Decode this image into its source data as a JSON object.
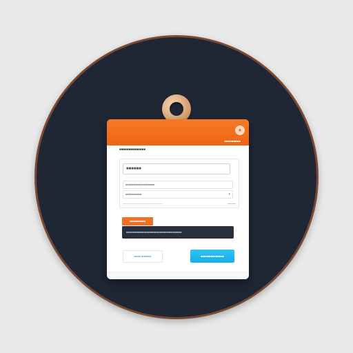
{
  "card": {
    "header_link": "■■■■■■■■■",
    "subheader": "■■■■■■■■■■■■■■",
    "fields": {
      "name_value": "■■■■■■",
      "field2_placeholder": "■■■■■■■■■■■■■■■■■■■■",
      "field3_placeholder": "■■■■■■■■■■■",
      "hint": "■■■■■■■■■■■■■■■■■■■■■■"
    },
    "orange_tag": "■■■■■■■■■■■",
    "dark_bar_text": "■■■■■■■■■■■■■■■■■■■■■■■■■■■■■■■■■■■■■■",
    "secondary_button": "■■■■  ■■■■■■",
    "primary_button": "■■■■■■■■■■■■■■"
  },
  "colors": {
    "background": "#e9e9e9",
    "circle": "#1f2735",
    "circle_border": "#7a4a33",
    "header": "#f36f21",
    "primary": "#14aee8",
    "dark_bar": "#26303f"
  },
  "icons": {
    "ring": "ring-hanger-icon",
    "header_badge": "circle-badge-icon",
    "chevron": "chevron-down-icon"
  }
}
